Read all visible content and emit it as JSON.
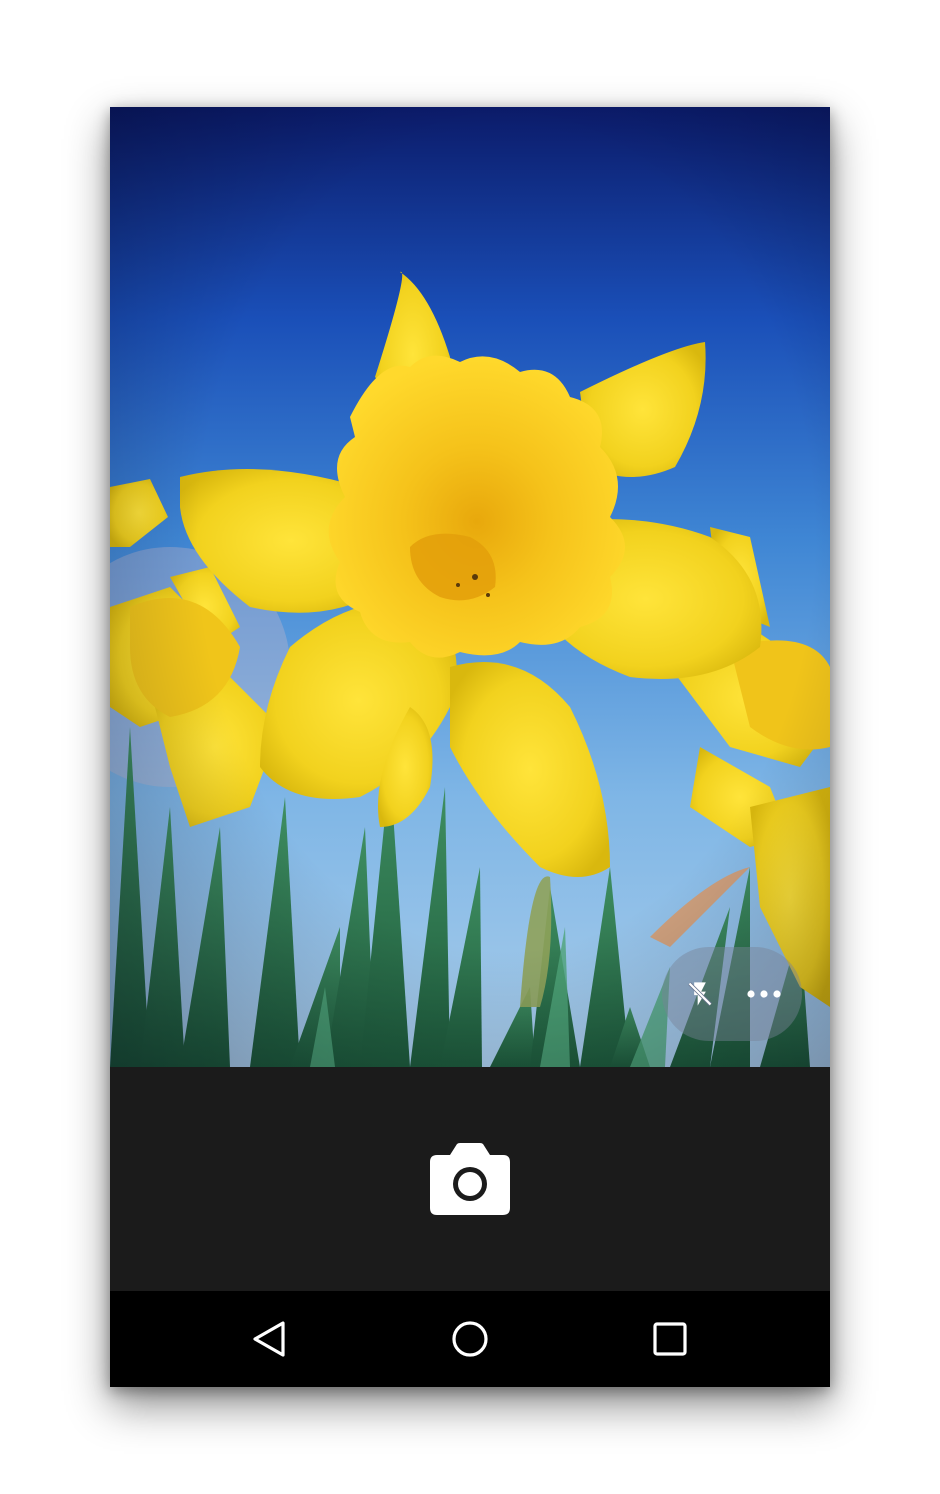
{
  "app": {
    "name": "Camera"
  },
  "viewfinder": {
    "subject": "yellow-daffodils"
  },
  "quick_controls": {
    "flash_icon": "flash-off-icon",
    "overflow_icon": "more-horizontal-icon"
  },
  "capture": {
    "icon": "camera-icon"
  },
  "navigation": {
    "back_icon": "back-triangle-icon",
    "home_icon": "home-circle-icon",
    "recents_icon": "recents-square-icon"
  },
  "colors": {
    "bottom_bar": "#1b1b1b",
    "nav_bar": "#000000",
    "icon": "#ffffff",
    "petal": "#f2d21e",
    "sky_top": "#0b1b6a",
    "sky_bottom": "#a9cdea"
  }
}
